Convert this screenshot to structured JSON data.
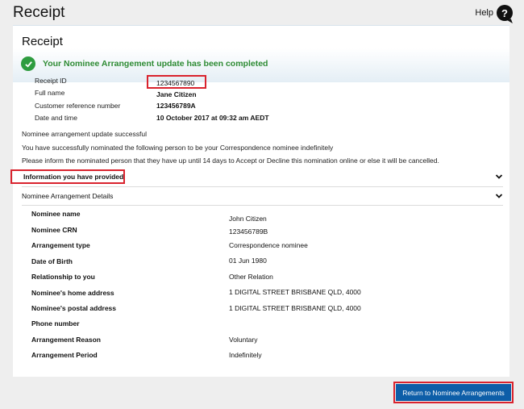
{
  "page": {
    "title": "Receipt",
    "help_label": "Help",
    "help_glyph": "?"
  },
  "card": {
    "title": "Receipt",
    "success_message": "Your Nominee Arrangement update has been completed",
    "meta": [
      {
        "label": "Receipt ID",
        "value": "1234567890"
      },
      {
        "label": "Full name",
        "value": "Jane Citizen"
      },
      {
        "label": "Customer reference number",
        "value": "123456789A"
      },
      {
        "label": "Date and time",
        "value": "10 October 2017 at 09:32 am AEDT"
      }
    ],
    "messages": [
      "Nominee arrangement update successful",
      "You have successfully nominated the following person to be your Correspondence nominee indefinitely",
      "Please inform the nominated person that they have up until 14 days to Accept or Decline this nomination online or else it will be cancelled."
    ],
    "sections": {
      "info_provided": "Information you have provided",
      "details": "Nominee Arrangement Details"
    },
    "details": [
      {
        "label": "Nominee name",
        "value": "John Citizen"
      },
      {
        "label": "Nominee CRN",
        "value": "123456789B"
      },
      {
        "label": "Arrangement type",
        "value": "Correspondence nominee"
      },
      {
        "label": "Date of Birth",
        "value": "01 Jun 1980"
      },
      {
        "label": "Relationship to you",
        "value": "Other Relation"
      },
      {
        "label": "Nominee's home address",
        "value": "1 DIGITAL STREET BRISBANE QLD, 4000"
      },
      {
        "label": "Nominee's postal address",
        "value": "1 DIGITAL STREET BRISBANE QLD, 4000"
      },
      {
        "label": "Phone number",
        "value": ""
      },
      {
        "label": "Arrangement Reason",
        "value": "Voluntary"
      },
      {
        "label": "Arrangement Period",
        "value": "Indefinitely"
      }
    ]
  },
  "actions": {
    "return_label": "Return to Nominee Arrangements"
  },
  "colors": {
    "success": "#2e8b34",
    "primary_button": "#0d5ea8",
    "highlight": "#d9232e"
  }
}
